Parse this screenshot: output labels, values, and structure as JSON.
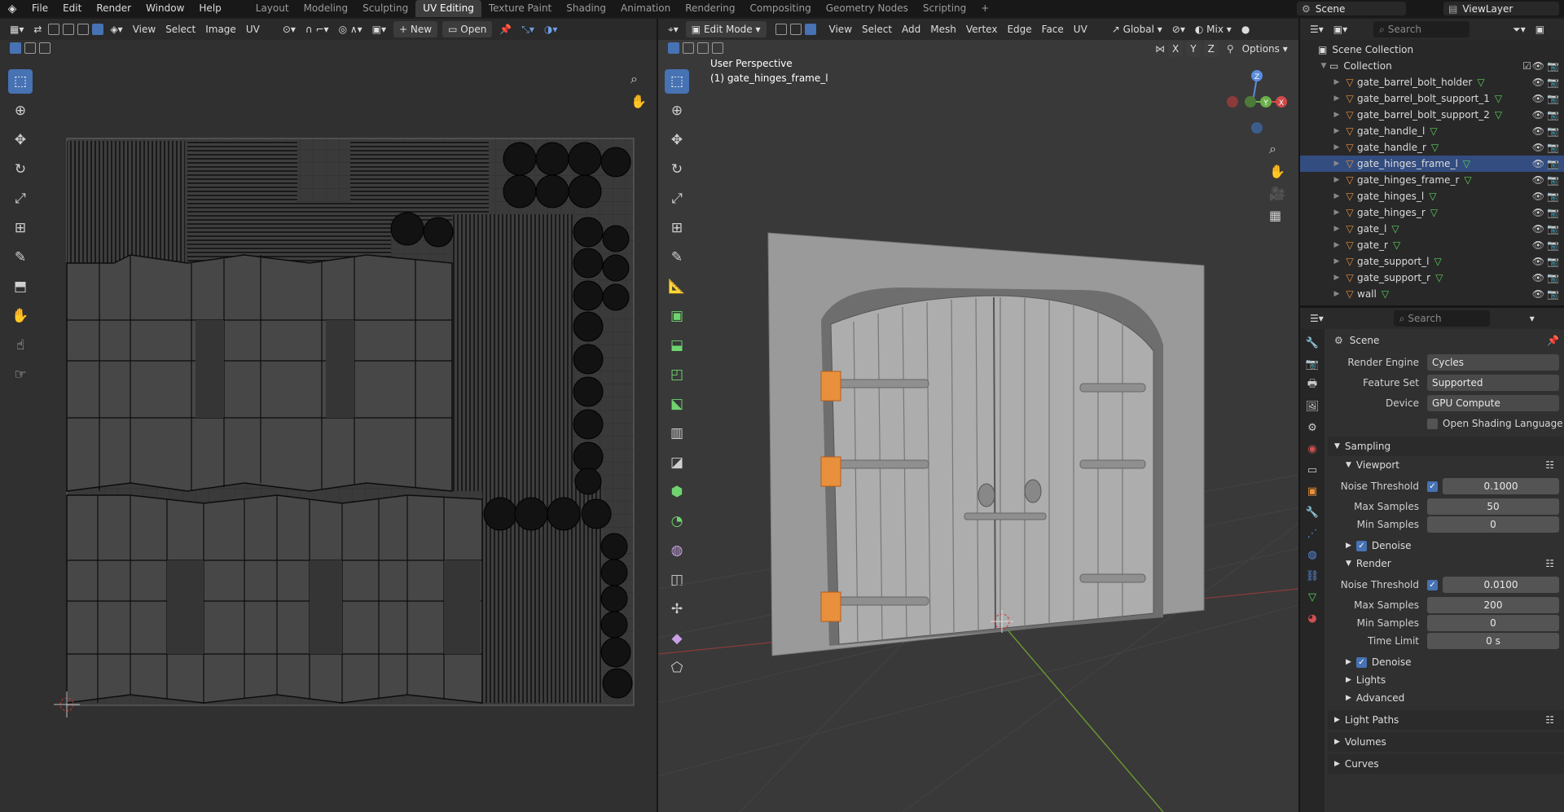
{
  "top_menu": {
    "file": "File",
    "edit": "Edit",
    "render": "Render",
    "window": "Window",
    "help": "Help"
  },
  "workspaces": [
    "Layout",
    "Modeling",
    "Sculpting",
    "UV Editing",
    "Texture Paint",
    "Shading",
    "Animation",
    "Rendering",
    "Compositing",
    "Geometry Nodes",
    "Scripting"
  ],
  "active_workspace": "UV Editing",
  "add_workspace": "+",
  "scene_name": "Scene",
  "view_layer": "ViewLayer",
  "uv_editor": {
    "menus": [
      "View",
      "Select",
      "Image",
      "UV"
    ],
    "new_label": "New",
    "open_label": "Open"
  },
  "viewport": {
    "mode": "Edit Mode",
    "menus": [
      "View",
      "Select",
      "Add",
      "Mesh",
      "Vertex",
      "Edge",
      "Face",
      "UV"
    ],
    "orientation": "Global",
    "shading_mix": "Mix",
    "options": "Options",
    "perspective": "User Perspective",
    "object_info": "(1) gate_hinges_frame_l",
    "axis_x": "X",
    "axis_y": "Y",
    "axis_z": "Z"
  },
  "outliner": {
    "search_placeholder": "Search",
    "root": "Scene Collection",
    "collection": "Collection",
    "items": [
      {
        "name": "gate_barrel_bolt_holder",
        "selected": false
      },
      {
        "name": "gate_barrel_bolt_support_1",
        "selected": false
      },
      {
        "name": "gate_barrel_bolt_support_2",
        "selected": false
      },
      {
        "name": "gate_handle_l",
        "selected": false
      },
      {
        "name": "gate_handle_r",
        "selected": false
      },
      {
        "name": "gate_hinges_frame_l",
        "selected": true
      },
      {
        "name": "gate_hinges_frame_r",
        "selected": false
      },
      {
        "name": "gate_hinges_l",
        "selected": false
      },
      {
        "name": "gate_hinges_r",
        "selected": false
      },
      {
        "name": "gate_l",
        "selected": false
      },
      {
        "name": "gate_r",
        "selected": false
      },
      {
        "name": "gate_support_l",
        "selected": false
      },
      {
        "name": "gate_support_r",
        "selected": false
      },
      {
        "name": "wall",
        "selected": false
      }
    ]
  },
  "properties": {
    "search_placeholder": "Search",
    "context": "Scene",
    "render_engine_label": "Render Engine",
    "render_engine": "Cycles",
    "feature_set_label": "Feature Set",
    "feature_set": "Supported",
    "device_label": "Device",
    "device": "GPU Compute",
    "osl_label": "Open Shading Language",
    "sampling": "Sampling",
    "viewport": "Viewport",
    "vp_noise_label": "Noise Threshold",
    "vp_noise": "0.1000",
    "vp_max_label": "Max Samples",
    "vp_max": "50",
    "vp_min_label": "Min Samples",
    "vp_min": "0",
    "denoise": "Denoise",
    "render": "Render",
    "r_noise_label": "Noise Threshold",
    "r_noise": "0.0100",
    "r_max_label": "Max Samples",
    "r_max": "200",
    "r_min_label": "Min Samples",
    "r_min": "0",
    "r_time_label": "Time Limit",
    "r_time": "0 s",
    "r_denoise": "Denoise",
    "lights": "Lights",
    "advanced": "Advanced",
    "light_paths": "Light Paths",
    "volumes": "Volumes",
    "curves": "Curves"
  },
  "colors": {
    "accent": "#4772b3",
    "selection": "#334d80",
    "orange": "#e8903c",
    "mesh_green": "#5bd25b"
  }
}
